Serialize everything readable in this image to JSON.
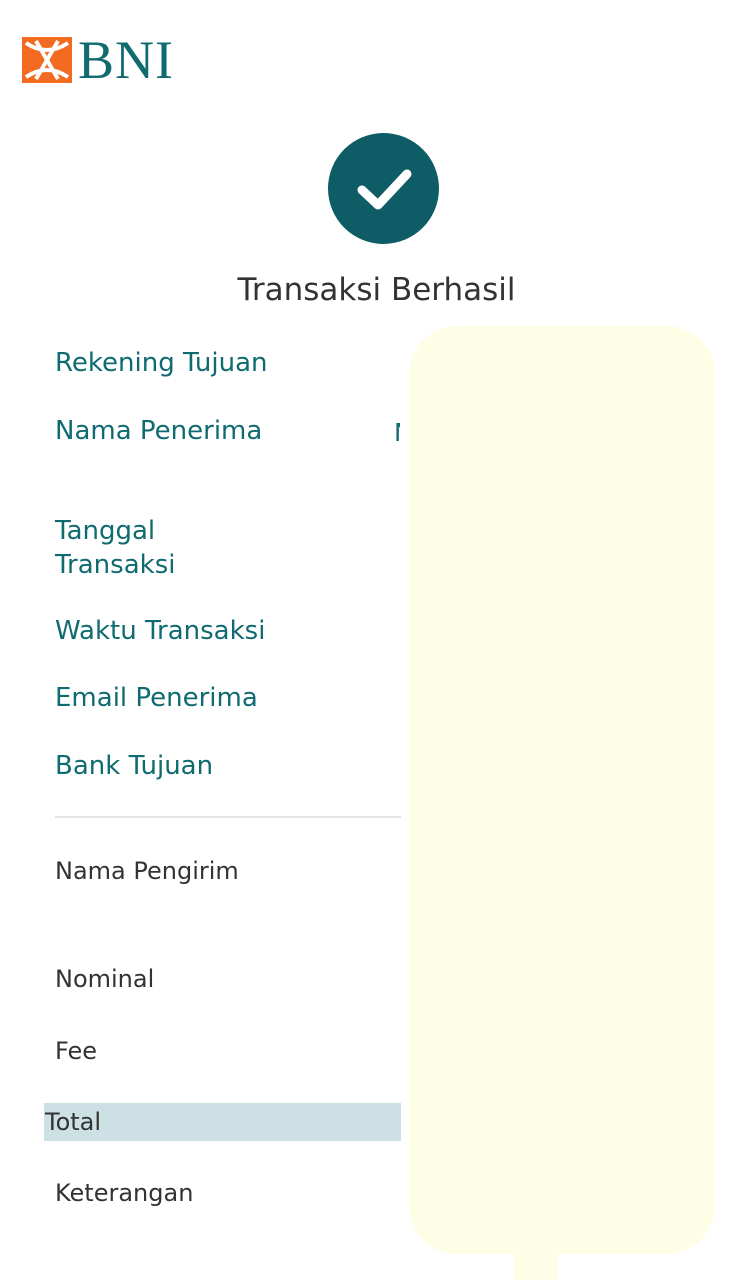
{
  "header": {
    "bank_name": "BNI",
    "brand_color": "#0f6b6f",
    "logo_accent_color": "#f26b21"
  },
  "status": {
    "icon": "check-icon",
    "icon_bg_color": "#0d5c66",
    "title": "Transaksi Berhasil"
  },
  "details": {
    "rekening_tujuan": "Rekening Tujuan",
    "nama_penerima": "Nama Penerima",
    "nama_penerima_value_partial": "N",
    "tanggal_transaksi_line1": "Tanggal",
    "tanggal_transaksi_line2": "Transaksi",
    "waktu_transaksi": "Waktu Transaksi",
    "email_penerima": "Email Penerima",
    "bank_tujuan": "Bank Tujuan"
  },
  "summary": {
    "nama_pengirim": "Nama Pengirim",
    "nominal": "Nominal",
    "fee": "Fee",
    "total": "Total",
    "keterangan": "Keterangan"
  }
}
